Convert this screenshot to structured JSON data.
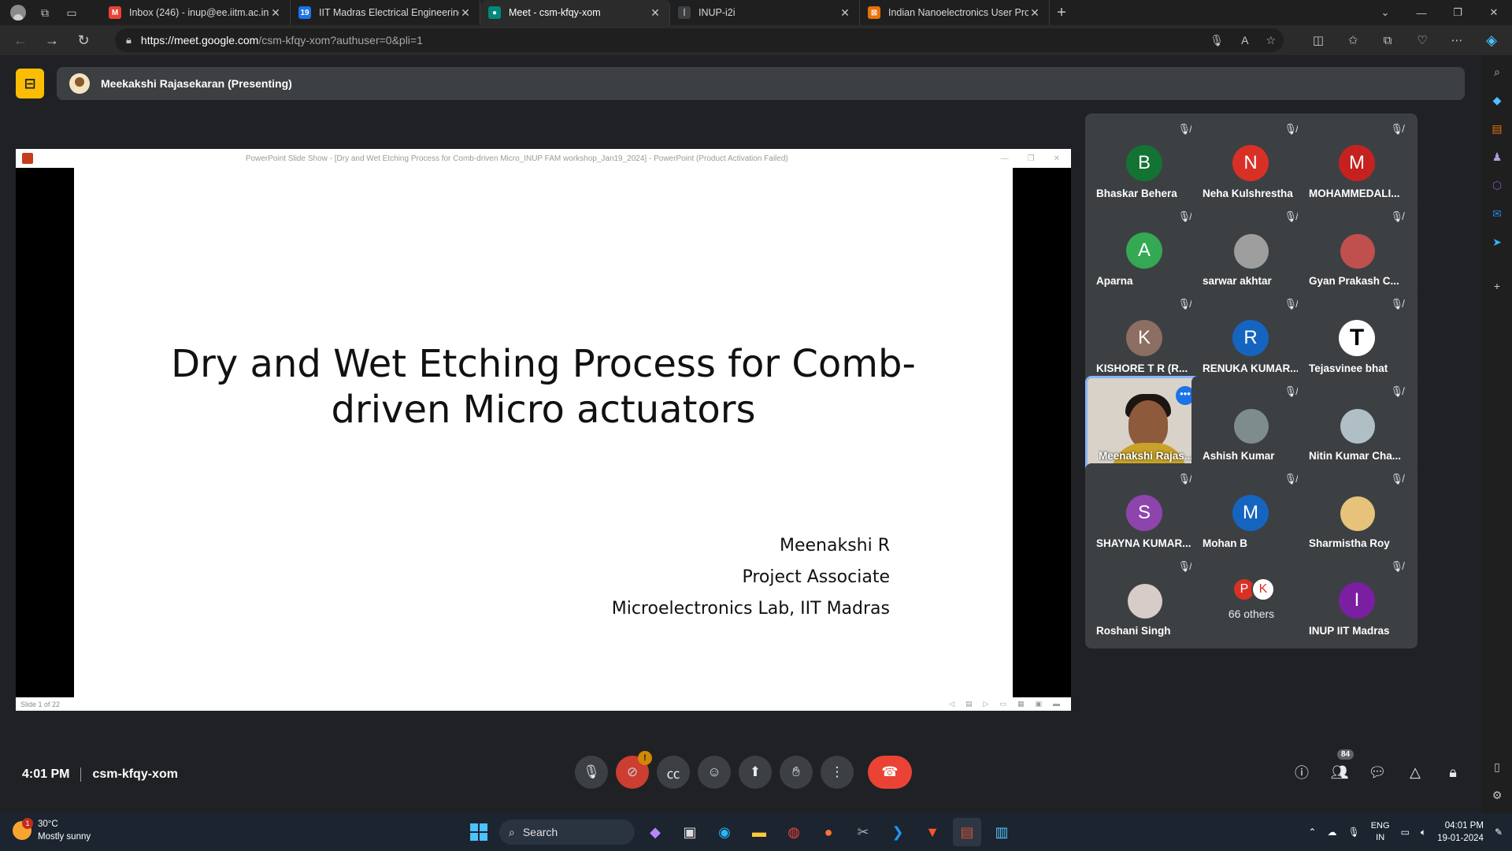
{
  "browser": {
    "tabs": [
      {
        "title": "Inbox (246) - inup@ee.iitm.ac.in",
        "favicon_color": "#ea4335",
        "favicon_glyph": "M",
        "active": false
      },
      {
        "title": "IIT Madras Electrical Engineering",
        "favicon_color": "#1a73e8",
        "favicon_glyph": "19",
        "active": false
      },
      {
        "title": "Meet - csm-kfqy-xom",
        "favicon_color": "#00897b",
        "favicon_glyph": "●",
        "active": true
      },
      {
        "title": "INUP-i2i",
        "favicon_color": "#3c4043",
        "favicon_glyph": "ᛁ",
        "active": false
      },
      {
        "title": "Indian Nanoelectronics User Prog",
        "favicon_color": "#e8710a",
        "favicon_glyph": "⊠",
        "active": false
      }
    ],
    "url_host": "https://meet.google.com",
    "url_path": "/csm-kfqy-xom?authuser=0&pli=1"
  },
  "meet": {
    "presenter_banner": "Meekakshi Rajasekaran (Presenting)",
    "meeting_code": "csm-kfqy-xom",
    "time": "4:01 PM",
    "participant_count": "84",
    "camera_alert": "!"
  },
  "ppt": {
    "window_title": "PowerPoint Slide Show - [Dry and Wet Etching Process for Comb-driven Micro_INUP FAM workshop_Jan19_2024] - PowerPoint (Product Activation Failed)",
    "slide_counter": "Slide 1 of 22"
  },
  "slide": {
    "title_line1": "Dry and Wet Etching Process for Comb-",
    "title_line2": "driven Micro actuators",
    "author": "Meenakshi R",
    "role": "Project Associate",
    "affiliation": "Microelectronics Lab, IIT Madras"
  },
  "participants": [
    {
      "name": "Bhaskar Behera",
      "initial": "B",
      "color": "#137333",
      "kind": "letter"
    },
    {
      "name": "Neha Kulshrestha",
      "initial": "N",
      "color": "#d93025",
      "kind": "letter"
    },
    {
      "name": "MOHAMMEDALI...",
      "initial": "M",
      "color": "#c5221f",
      "kind": "letter"
    },
    {
      "name": "Aparna",
      "initial": "A",
      "color": "#34a853",
      "kind": "letter"
    },
    {
      "name": "sarwar akhtar",
      "initial": "",
      "color": "#9e9e9e",
      "kind": "photo"
    },
    {
      "name": "Gyan Prakash C...",
      "initial": "",
      "color": "#c0504d",
      "kind": "photo"
    },
    {
      "name": "KISHORE T R (R...",
      "initial": "K",
      "color": "#8d6e63",
      "kind": "letter"
    },
    {
      "name": "RENUKA KUMAR...",
      "initial": "R",
      "color": "#1565c0",
      "kind": "letter"
    },
    {
      "name": "Tejasvinee bhat",
      "initial": "T",
      "color": "#ffffff",
      "kind": "logo"
    },
    {
      "name": "Meenakshi Rajas...",
      "initial": "",
      "color": "#d9d2c8",
      "kind": "speaker"
    },
    {
      "name": "Ashish Kumar",
      "initial": "",
      "color": "#7f8c8d",
      "kind": "photo"
    },
    {
      "name": "Nitin Kumar Cha...",
      "initial": "",
      "color": "#b0bec5",
      "kind": "photo"
    },
    {
      "name": "SHAYNA KUMAR...",
      "initial": "S",
      "color": "#8e44ad",
      "kind": "letter"
    },
    {
      "name": "Mohan B",
      "initial": "M",
      "color": "#1565c0",
      "kind": "letter"
    },
    {
      "name": "Sharmistha Roy",
      "initial": "",
      "color": "#e6c27a",
      "kind": "photo"
    },
    {
      "name": "Roshani Singh",
      "initial": "",
      "color": "#d7ccc8",
      "kind": "photo"
    },
    {
      "name": "66 others",
      "initial": "P",
      "color": "#d93025",
      "kind": "others"
    },
    {
      "name": "INUP IIT Madras",
      "initial": "I",
      "color": "#7b1fa2",
      "kind": "letter"
    }
  ],
  "taskbar": {
    "temperature": "30°C",
    "weather": "Mostly sunny",
    "weather_badge": "1",
    "search_label": "Search",
    "lang_1": "ENG",
    "lang_2": "IN",
    "clock_time": "04:01 PM",
    "clock_date": "19-01-2024"
  }
}
